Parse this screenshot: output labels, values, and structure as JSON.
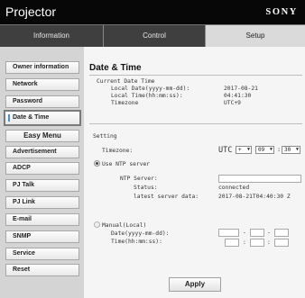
{
  "app": {
    "title": "Projector",
    "brand": "SONY"
  },
  "tabs": [
    {
      "label": "Information",
      "active": false
    },
    {
      "label": "Control",
      "active": false
    },
    {
      "label": "Setup",
      "active": true
    }
  ],
  "sidebar": {
    "items": [
      {
        "label": "Owner information"
      },
      {
        "label": "Network"
      },
      {
        "label": "Password"
      },
      {
        "label": "Date & Time",
        "active": true
      },
      {
        "label": "Easy Menu"
      },
      {
        "label": "Advertisement"
      },
      {
        "label": "ADCP"
      },
      {
        "label": "PJ Talk"
      },
      {
        "label": "PJ Link"
      },
      {
        "label": "E-mail"
      },
      {
        "label": "SNMP"
      },
      {
        "label": "Service"
      },
      {
        "label": "Reset"
      }
    ]
  },
  "main": {
    "heading": "Date & Time",
    "current": {
      "section_label": "Current Date Time",
      "local_date_label": "Local Date(yyyy-mm-dd):",
      "local_date_value": "2017-08-21",
      "local_time_label": "Local Time(hh:mm:ss):",
      "local_time_value": "04:41:30",
      "timezone_label": "Timezone",
      "timezone_value": "UTC+9"
    },
    "setting": {
      "section_label": "Setting",
      "timezone_label": "Timezone:",
      "tz_utc": "UTC",
      "tz_sign": "+",
      "tz_hour": "09",
      "tz_minute": "30",
      "ntp_radio_label": "Use NTP server",
      "ntp_server_label": "NTP Server:",
      "ntp_server_value": "",
      "status_label": "Status:",
      "status_value": "connected",
      "latest_label": "latest server data:",
      "latest_value": "2017-08-21T04:40:30 Z",
      "manual_radio_label": "Manual(Local)",
      "manual_date_label": "Date(yyyy-mm-dd):",
      "manual_time_label": "Time(hh:mm:ss):",
      "date_sep": "-",
      "time_sep": ":"
    },
    "apply_label": "Apply"
  }
}
